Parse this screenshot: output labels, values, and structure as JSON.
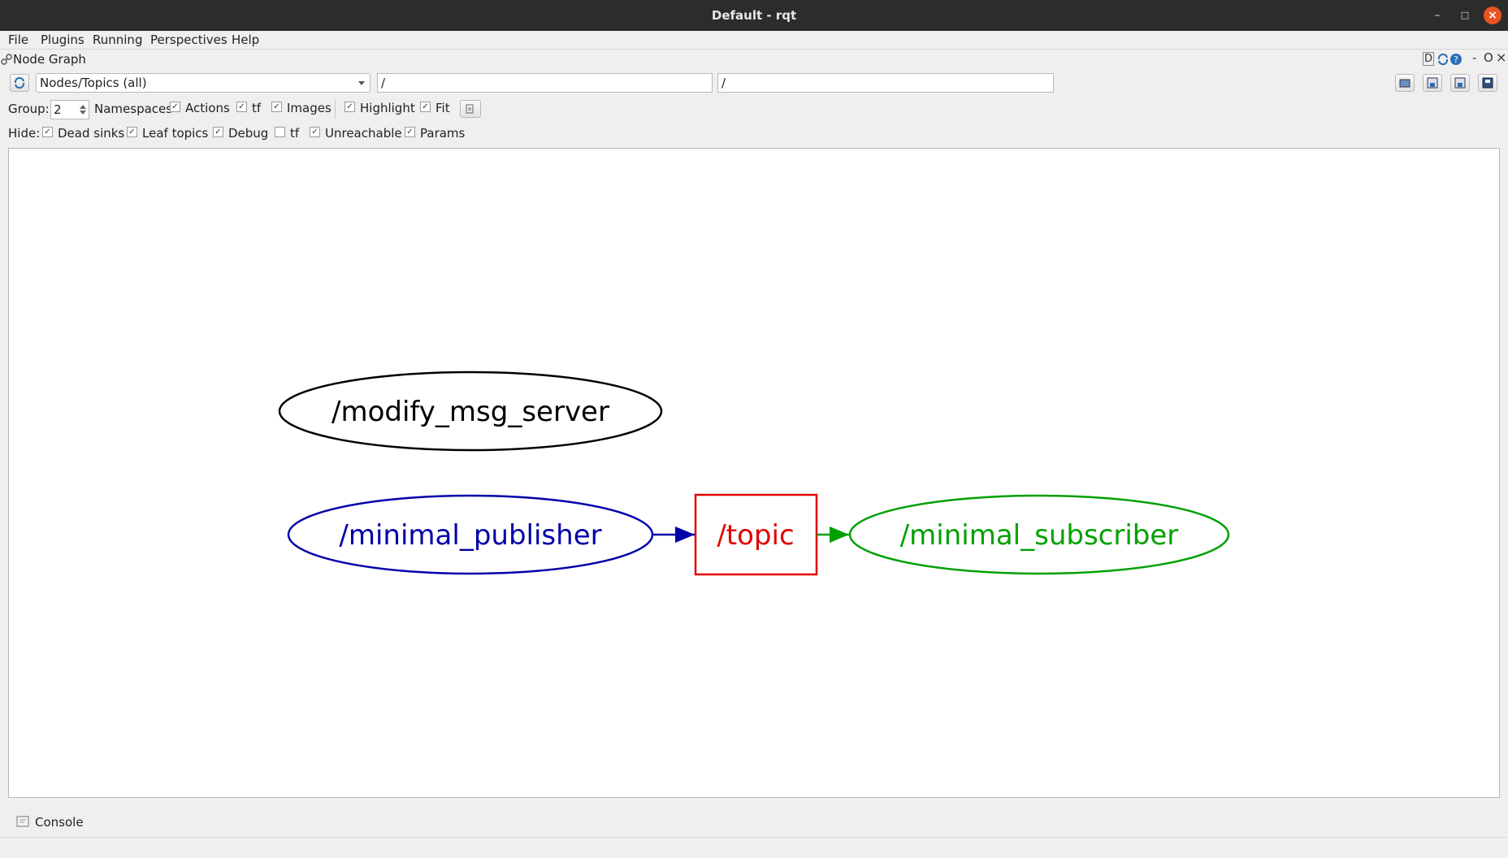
{
  "window": {
    "title": "Default - rqt"
  },
  "menu": [
    "File",
    "Plugins",
    "Running",
    "Perspectives",
    "Help"
  ],
  "dock": {
    "title": "Node Graph",
    "buttons": [
      "D",
      "-",
      "O"
    ]
  },
  "toolbar": {
    "graph_type": "Nodes/Topics (all)",
    "node_filter": "/",
    "topic_filter": "/"
  },
  "group_row": {
    "group_label": "Group:",
    "group_value": "2",
    "options": [
      {
        "label": "Namespaces",
        "checked": null
      },
      {
        "label": "Actions",
        "checked": true
      },
      {
        "label": "tf",
        "checked": true
      },
      {
        "label": "Images",
        "checked": true
      },
      {
        "label": "Highlight",
        "checked": true
      },
      {
        "label": "Fit",
        "checked": true
      }
    ]
  },
  "hide_row": {
    "label": "Hide:",
    "options": [
      {
        "label": "Dead sinks",
        "checked": true
      },
      {
        "label": "Leaf topics",
        "checked": true
      },
      {
        "label": "Debug",
        "checked": true
      },
      {
        "label": "tf",
        "checked": false
      },
      {
        "label": "Unreachable",
        "checked": true
      },
      {
        "label": "Params",
        "checked": true
      }
    ]
  },
  "graph": {
    "nodes": [
      {
        "label": "/modify_msg_server",
        "color": "#000000"
      },
      {
        "label": "/minimal_publisher",
        "color": "#0000aa"
      },
      {
        "label": "/topic",
        "color": "#e00000"
      },
      {
        "label": "/minimal_subscriber",
        "color": "#00a000"
      }
    ]
  },
  "console": {
    "label": "Console"
  }
}
